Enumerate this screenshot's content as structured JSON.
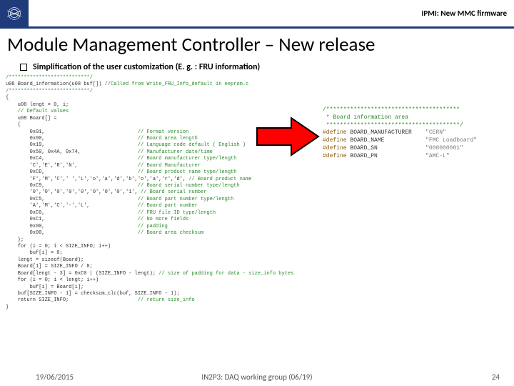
{
  "header": {
    "title_right": "IPMI: New MMC firmware"
  },
  "title": "Module Management Controller – New release",
  "bullet": "Simplification of the user customization (E. g. : FRU information)",
  "code_left": [
    {
      "c": "/***************************/"
    },
    {
      "t": "u08 Board_information(u08 buf[]) ",
      "c": "//Called from Write_FRU_Info_default in eeprom.c"
    },
    {
      "c": "/***************************/"
    },
    {
      "t": "{"
    },
    {
      "t": "    u08 lengt = 0, i;"
    },
    {
      "t": ""
    },
    {
      "t": "    ",
      "c": "// Default values"
    },
    {
      "t": "    u08 Board[] ="
    },
    {
      "t": "    {"
    },
    {
      "t": "        0x01,",
      "c2": "// Format version"
    },
    {
      "t": "        0x00,",
      "c2": "// Board area length"
    },
    {
      "t": "        0x19,",
      "c2": "// Language code default ( English )"
    },
    {
      "t": "        0x50, 0x4A, 0x74,",
      "c2": "// Manufacturer date/time"
    },
    {
      "t": "        0xC4,",
      "c2": "// Board manufacturer type/length"
    },
    {
      "t": "        'C','E','R','N',",
      "c2": "// Board Manufacturer"
    },
    {
      "t": "        0xCD,",
      "c2": "// Board product name type/length"
    },
    {
      "t": "        'F','M','C',' ','L','o','a','d','b','o','a','r','d',",
      "c2": "// Board product name"
    },
    {
      "t": "        0xC9,",
      "c2": "// Board serial number type/length"
    },
    {
      "t": "        '0','0','0','0','0','0','0','0','1',",
      "c2": "// Board serial number"
    },
    {
      "t": "        0xC5,",
      "c2": "// Board part number type/length"
    },
    {
      "t": "        'A','M','C','-','L',",
      "c2": "// Board part number"
    },
    {
      "t": "        0xC0,",
      "c2": "// FRU file ID type/length"
    },
    {
      "t": "        0xC1,",
      "c2": "// No more fields"
    },
    {
      "t": "        0x00,",
      "c2": "// padding"
    },
    {
      "t": "        0x00,",
      "c2": "// Board area checksum"
    },
    {
      "t": "    };"
    },
    {
      "t": ""
    },
    {
      "t": "    for (i = 0; i < SIZE_INFO; i++)"
    },
    {
      "t": "        buf[i] = 0;"
    },
    {
      "t": ""
    },
    {
      "t": "    lengt = sizeof(Board);"
    },
    {
      "t": "    Board[1] = SIZE_INFO / 8;"
    },
    {
      "t": "    Board[lengt - 3] = 0xC0 | (SIZE_INFO - lengt);",
      "c2": "// size of padding for data - size_info bytes"
    },
    {
      "t": ""
    },
    {
      "t": "    for (i = 0; i < lengt; i++)"
    },
    {
      "t": "        buf[i] = Board[i];"
    },
    {
      "t": ""
    },
    {
      "t": "    buf[SIZE_INFO - 1] = checksum_clc(buf, SIZE_INFO - 1);"
    },
    {
      "t": "    return SIZE_INFO; ",
      "c2": "// return size_info"
    },
    {
      "t": "}"
    }
  ],
  "code_right": [
    {
      "cm": "/***************************************"
    },
    {
      "cm": " * Board information area              "
    },
    {
      "cm": " ***************************************/"
    },
    {
      "kw": "#define ",
      "id": "BOARD_MANUFACTURER",
      "val": "\"CERN\""
    },
    {
      "kw": "#define ",
      "id": "BOARD_NAME",
      "val": "\"FMC Loadboard\""
    },
    {
      "kw": "#define ",
      "id": "BOARD_SN",
      "val": "\"000000001\""
    },
    {
      "kw": "#define ",
      "id": "BOARD_PN",
      "val": "\"AMC-L\""
    }
  ],
  "footer": {
    "date": "19/06/2015",
    "center": "IN2P3: DAQ working group (06/19)",
    "page": "24"
  }
}
